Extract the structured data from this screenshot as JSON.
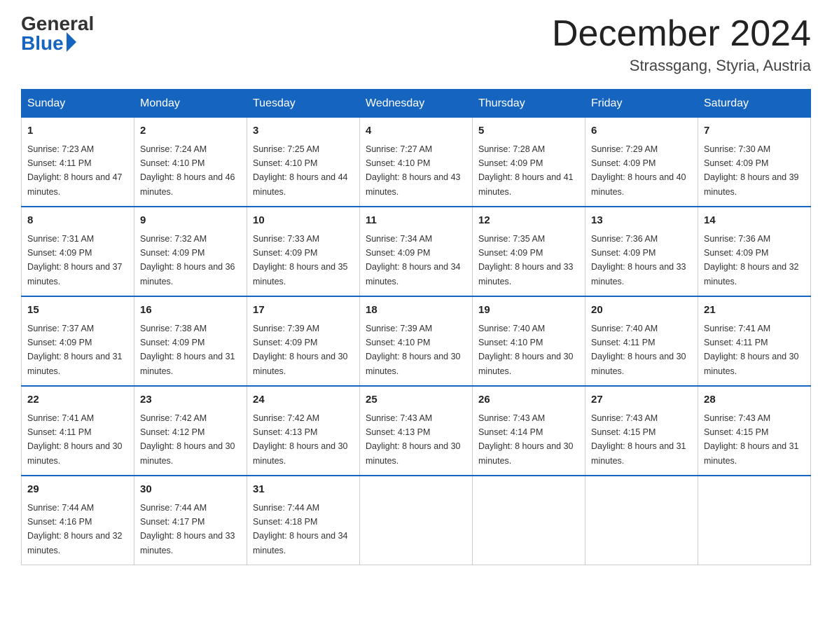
{
  "header": {
    "logo_general": "General",
    "logo_blue": "Blue",
    "month_year": "December 2024",
    "location": "Strassgang, Styria, Austria"
  },
  "weekdays": [
    "Sunday",
    "Monday",
    "Tuesday",
    "Wednesday",
    "Thursday",
    "Friday",
    "Saturday"
  ],
  "weeks": [
    [
      {
        "day": "1",
        "sunrise": "7:23 AM",
        "sunset": "4:11 PM",
        "daylight": "8 hours and 47 minutes."
      },
      {
        "day": "2",
        "sunrise": "7:24 AM",
        "sunset": "4:10 PM",
        "daylight": "8 hours and 46 minutes."
      },
      {
        "day": "3",
        "sunrise": "7:25 AM",
        "sunset": "4:10 PM",
        "daylight": "8 hours and 44 minutes."
      },
      {
        "day": "4",
        "sunrise": "7:27 AM",
        "sunset": "4:10 PM",
        "daylight": "8 hours and 43 minutes."
      },
      {
        "day": "5",
        "sunrise": "7:28 AM",
        "sunset": "4:09 PM",
        "daylight": "8 hours and 41 minutes."
      },
      {
        "day": "6",
        "sunrise": "7:29 AM",
        "sunset": "4:09 PM",
        "daylight": "8 hours and 40 minutes."
      },
      {
        "day": "7",
        "sunrise": "7:30 AM",
        "sunset": "4:09 PM",
        "daylight": "8 hours and 39 minutes."
      }
    ],
    [
      {
        "day": "8",
        "sunrise": "7:31 AM",
        "sunset": "4:09 PM",
        "daylight": "8 hours and 37 minutes."
      },
      {
        "day": "9",
        "sunrise": "7:32 AM",
        "sunset": "4:09 PM",
        "daylight": "8 hours and 36 minutes."
      },
      {
        "day": "10",
        "sunrise": "7:33 AM",
        "sunset": "4:09 PM",
        "daylight": "8 hours and 35 minutes."
      },
      {
        "day": "11",
        "sunrise": "7:34 AM",
        "sunset": "4:09 PM",
        "daylight": "8 hours and 34 minutes."
      },
      {
        "day": "12",
        "sunrise": "7:35 AM",
        "sunset": "4:09 PM",
        "daylight": "8 hours and 33 minutes."
      },
      {
        "day": "13",
        "sunrise": "7:36 AM",
        "sunset": "4:09 PM",
        "daylight": "8 hours and 33 minutes."
      },
      {
        "day": "14",
        "sunrise": "7:36 AM",
        "sunset": "4:09 PM",
        "daylight": "8 hours and 32 minutes."
      }
    ],
    [
      {
        "day": "15",
        "sunrise": "7:37 AM",
        "sunset": "4:09 PM",
        "daylight": "8 hours and 31 minutes."
      },
      {
        "day": "16",
        "sunrise": "7:38 AM",
        "sunset": "4:09 PM",
        "daylight": "8 hours and 31 minutes."
      },
      {
        "day": "17",
        "sunrise": "7:39 AM",
        "sunset": "4:09 PM",
        "daylight": "8 hours and 30 minutes."
      },
      {
        "day": "18",
        "sunrise": "7:39 AM",
        "sunset": "4:10 PM",
        "daylight": "8 hours and 30 minutes."
      },
      {
        "day": "19",
        "sunrise": "7:40 AM",
        "sunset": "4:10 PM",
        "daylight": "8 hours and 30 minutes."
      },
      {
        "day": "20",
        "sunrise": "7:40 AM",
        "sunset": "4:11 PM",
        "daylight": "8 hours and 30 minutes."
      },
      {
        "day": "21",
        "sunrise": "7:41 AM",
        "sunset": "4:11 PM",
        "daylight": "8 hours and 30 minutes."
      }
    ],
    [
      {
        "day": "22",
        "sunrise": "7:41 AM",
        "sunset": "4:11 PM",
        "daylight": "8 hours and 30 minutes."
      },
      {
        "day": "23",
        "sunrise": "7:42 AM",
        "sunset": "4:12 PM",
        "daylight": "8 hours and 30 minutes."
      },
      {
        "day": "24",
        "sunrise": "7:42 AM",
        "sunset": "4:13 PM",
        "daylight": "8 hours and 30 minutes."
      },
      {
        "day": "25",
        "sunrise": "7:43 AM",
        "sunset": "4:13 PM",
        "daylight": "8 hours and 30 minutes."
      },
      {
        "day": "26",
        "sunrise": "7:43 AM",
        "sunset": "4:14 PM",
        "daylight": "8 hours and 30 minutes."
      },
      {
        "day": "27",
        "sunrise": "7:43 AM",
        "sunset": "4:15 PM",
        "daylight": "8 hours and 31 minutes."
      },
      {
        "day": "28",
        "sunrise": "7:43 AM",
        "sunset": "4:15 PM",
        "daylight": "8 hours and 31 minutes."
      }
    ],
    [
      {
        "day": "29",
        "sunrise": "7:44 AM",
        "sunset": "4:16 PM",
        "daylight": "8 hours and 32 minutes."
      },
      {
        "day": "30",
        "sunrise": "7:44 AM",
        "sunset": "4:17 PM",
        "daylight": "8 hours and 33 minutes."
      },
      {
        "day": "31",
        "sunrise": "7:44 AM",
        "sunset": "4:18 PM",
        "daylight": "8 hours and 34 minutes."
      },
      null,
      null,
      null,
      null
    ]
  ],
  "labels": {
    "sunrise": "Sunrise: ",
    "sunset": "Sunset: ",
    "daylight": "Daylight: "
  }
}
